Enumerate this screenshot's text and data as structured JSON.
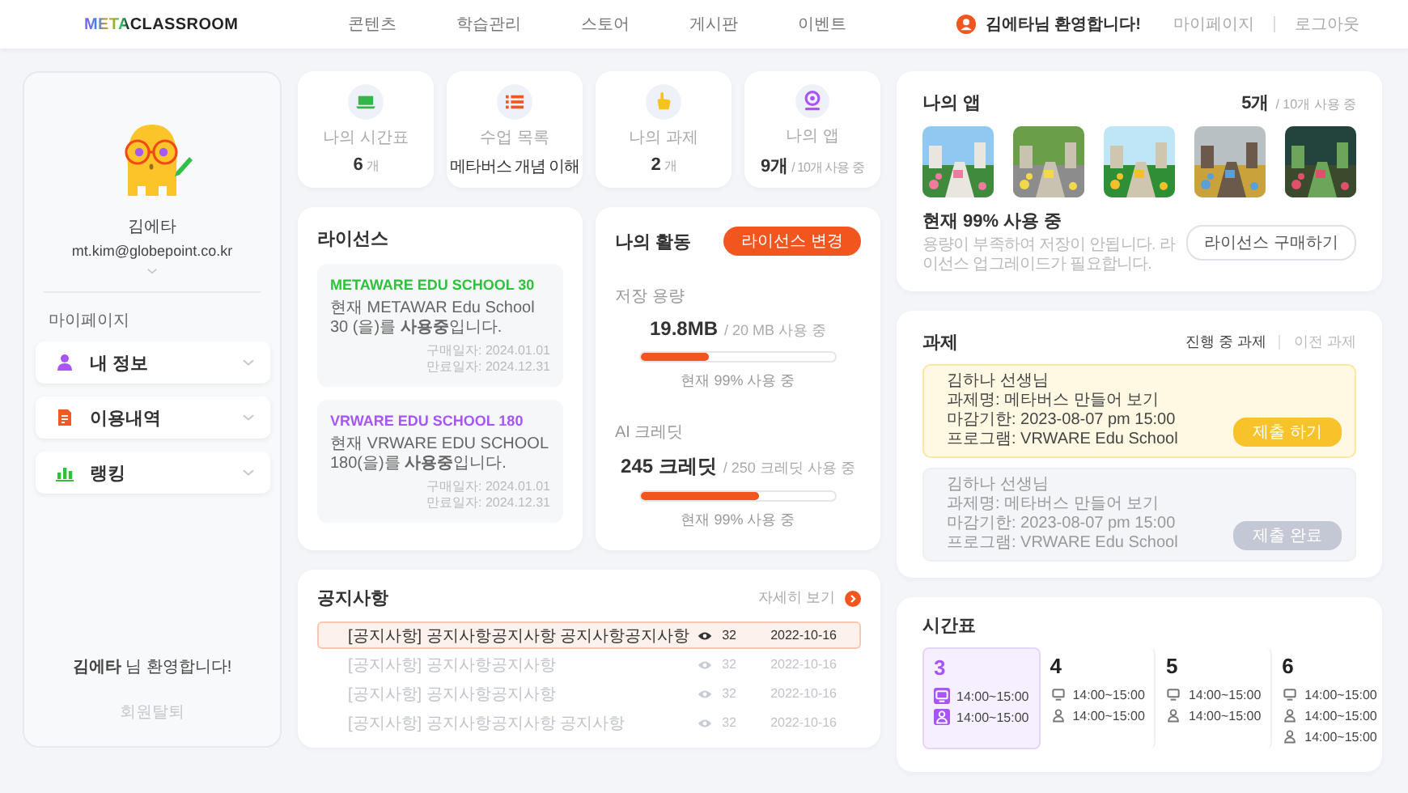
{
  "header": {
    "logo": "METACLASSROOM",
    "nav": [
      {
        "label": "콘텐츠"
      },
      {
        "label": "학습관리"
      },
      {
        "label": "스토어"
      },
      {
        "label": "게시판"
      },
      {
        "label": "이벤트"
      }
    ],
    "greeting": "김에타님 환영합니다!",
    "links": [
      "마이페이지",
      "로그아웃"
    ]
  },
  "profile": {
    "name": "김에타",
    "email": "mt.kim@globepoint.co.kr",
    "section_title": "마이페이지",
    "menu": [
      {
        "kind": "person",
        "label": "내 정보"
      },
      {
        "kind": "document",
        "label": "이용내역"
      },
      {
        "kind": "chart",
        "label": "랭킹"
      }
    ],
    "welcome": "**김에타** 님 환영합니다!",
    "withdraw": "회원탈퇴"
  },
  "stats": [
    {
      "kind": "timetable",
      "label": "나의 시간표",
      "value": "6",
      "unit": "개"
    },
    {
      "kind": "lessons",
      "label": "수업 목록",
      "value": "메타버스 개념 이해"
    },
    {
      "kind": "tasks",
      "label": "나의 과제",
      "value": "2",
      "unit": "개"
    },
    {
      "kind": "apps",
      "label": "나의 앱",
      "value": "9개",
      "unit": "/ 10개 사용 중"
    }
  ],
  "licenses": {
    "title": "라이선스",
    "items": [
      {
        "name": "METAWARE EDU SCHOOL 30",
        "color": "#2ec23a",
        "description": "현재 METAWAR Edu School 30 (을)를 **사용중**입니다.",
        "purchase_date": "구매일자: 2024.01.01",
        "expiry_date": "만료일자: 2024.12.31"
      },
      {
        "name": "VRWARE EDU SCHOOL 180",
        "color": "#a855f7",
        "description": "현재 VRWARE EDU SCHOOL 180(을)를 **사용중**입니다.",
        "purchase_date": "구매일자: 2024.01.01",
        "expiry_date": "만료일자: 2024.12.31"
      }
    ]
  },
  "activity": {
    "title": "나의 활동",
    "button": "라이선스 변경",
    "meters": [
      {
        "label": "저장 용량",
        "value": "19.8MB",
        "total": "/ 20 MB 사용 중",
        "level": 0.35,
        "caption": "현재 99% 사용 중"
      },
      {
        "label": "AI 크레딧",
        "value": "245 크레딧",
        "total": "/ 250 크레딧 사용 중",
        "level": 0.61,
        "caption": "현재 99% 사용 중"
      }
    ]
  },
  "apps": {
    "title": "나의 앱",
    "count": "5개",
    "total": "/ 10개 사용 중",
    "usage": "현재 99% 사용 중",
    "notice": "용량이 부족하여 저장이 안됩니다. 라이선스 업그레이드가 필요합니다.",
    "button": "라이선스 구매하기"
  },
  "tasks": {
    "title": "과제",
    "tabs": [
      {
        "label": "진행 중 과제",
        "selected": true
      },
      {
        "label": "이전 과제",
        "selected": false
      }
    ],
    "items": [
      {
        "teacher": "김하나 선생님",
        "name": "과제명: 메타버스 만들어 보기",
        "deadline": "마감기한: 2023-08-07 pm 15:00",
        "program": "프로그램: VRWARE Edu School",
        "button": "제출 하기",
        "submitted": false
      },
      {
        "teacher": "김하나 선생님",
        "name": "과제명: 메타버스 만들어 보기",
        "deadline": "마감기한: 2023-08-07 pm 15:00",
        "program": "프로그램: VRWARE Edu School",
        "button": "제출 완료",
        "submitted": true
      }
    ]
  },
  "notices": {
    "title": "공지사항",
    "more": "자세히 보기",
    "rows": [
      {
        "title": "[공지사항] 공지사항공지사항 공지사항공지사항",
        "views": "32",
        "date": "2022-10-16",
        "selected": true
      },
      {
        "title": "[공지사항] 공지사항공지사항",
        "views": "32",
        "date": "2022-10-16",
        "selected": false
      },
      {
        "title": "[공지사항] 공지사항공지사항",
        "views": "32",
        "date": "2022-10-16",
        "selected": false
      },
      {
        "title": "[공지사항] 공지사항공지사항 공지사항",
        "views": "32",
        "date": "2022-10-16",
        "selected": false
      }
    ]
  },
  "timetable": {
    "title": "시간표",
    "days": [
      {
        "day": "3",
        "selected": true,
        "entries": [
          {
            "kind": "screen",
            "time": "14:00~15:00"
          },
          {
            "kind": "person",
            "time": "14:00~15:00"
          }
        ]
      },
      {
        "day": "4",
        "selected": false,
        "entries": [
          {
            "kind": "screen",
            "time": "14:00~15:00"
          },
          {
            "kind": "person",
            "time": "14:00~15:00"
          }
        ]
      },
      {
        "day": "5",
        "selected": false,
        "entries": [
          {
            "kind": "screen",
            "time": "14:00~15:00"
          },
          {
            "kind": "person",
            "time": "14:00~15:00"
          }
        ]
      },
      {
        "day": "6",
        "selected": false,
        "entries": [
          {
            "kind": "screen",
            "time": "14:00~15:00"
          },
          {
            "kind": "person",
            "time": "14:00~15:00"
          },
          {
            "kind": "person",
            "time": "14:00~15:00"
          }
        ]
      }
    ]
  }
}
